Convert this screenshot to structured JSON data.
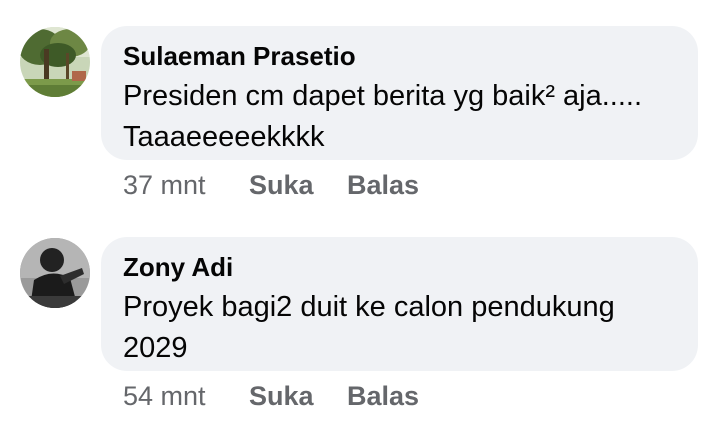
{
  "comments": [
    {
      "author": "Sulaeman Prasetio",
      "text": "Presiden cm dapet berita yg baik² aja..... Taaaeeeeekkkk",
      "time": "37 mnt",
      "like_label": "Suka",
      "reply_label": "Balas",
      "avatar_icon": "tree-garden-avatar"
    },
    {
      "author": "Zony Adi",
      "text": "Proyek bagi2 duit ke calon pendukung 2029",
      "time": "54 mnt",
      "like_label": "Suka",
      "reply_label": "Balas",
      "avatar_icon": "dark-person-avatar"
    }
  ],
  "colors": {
    "bubble_bg": "#f0f2f5",
    "text_primary": "#050505",
    "text_secondary": "#65676b"
  }
}
